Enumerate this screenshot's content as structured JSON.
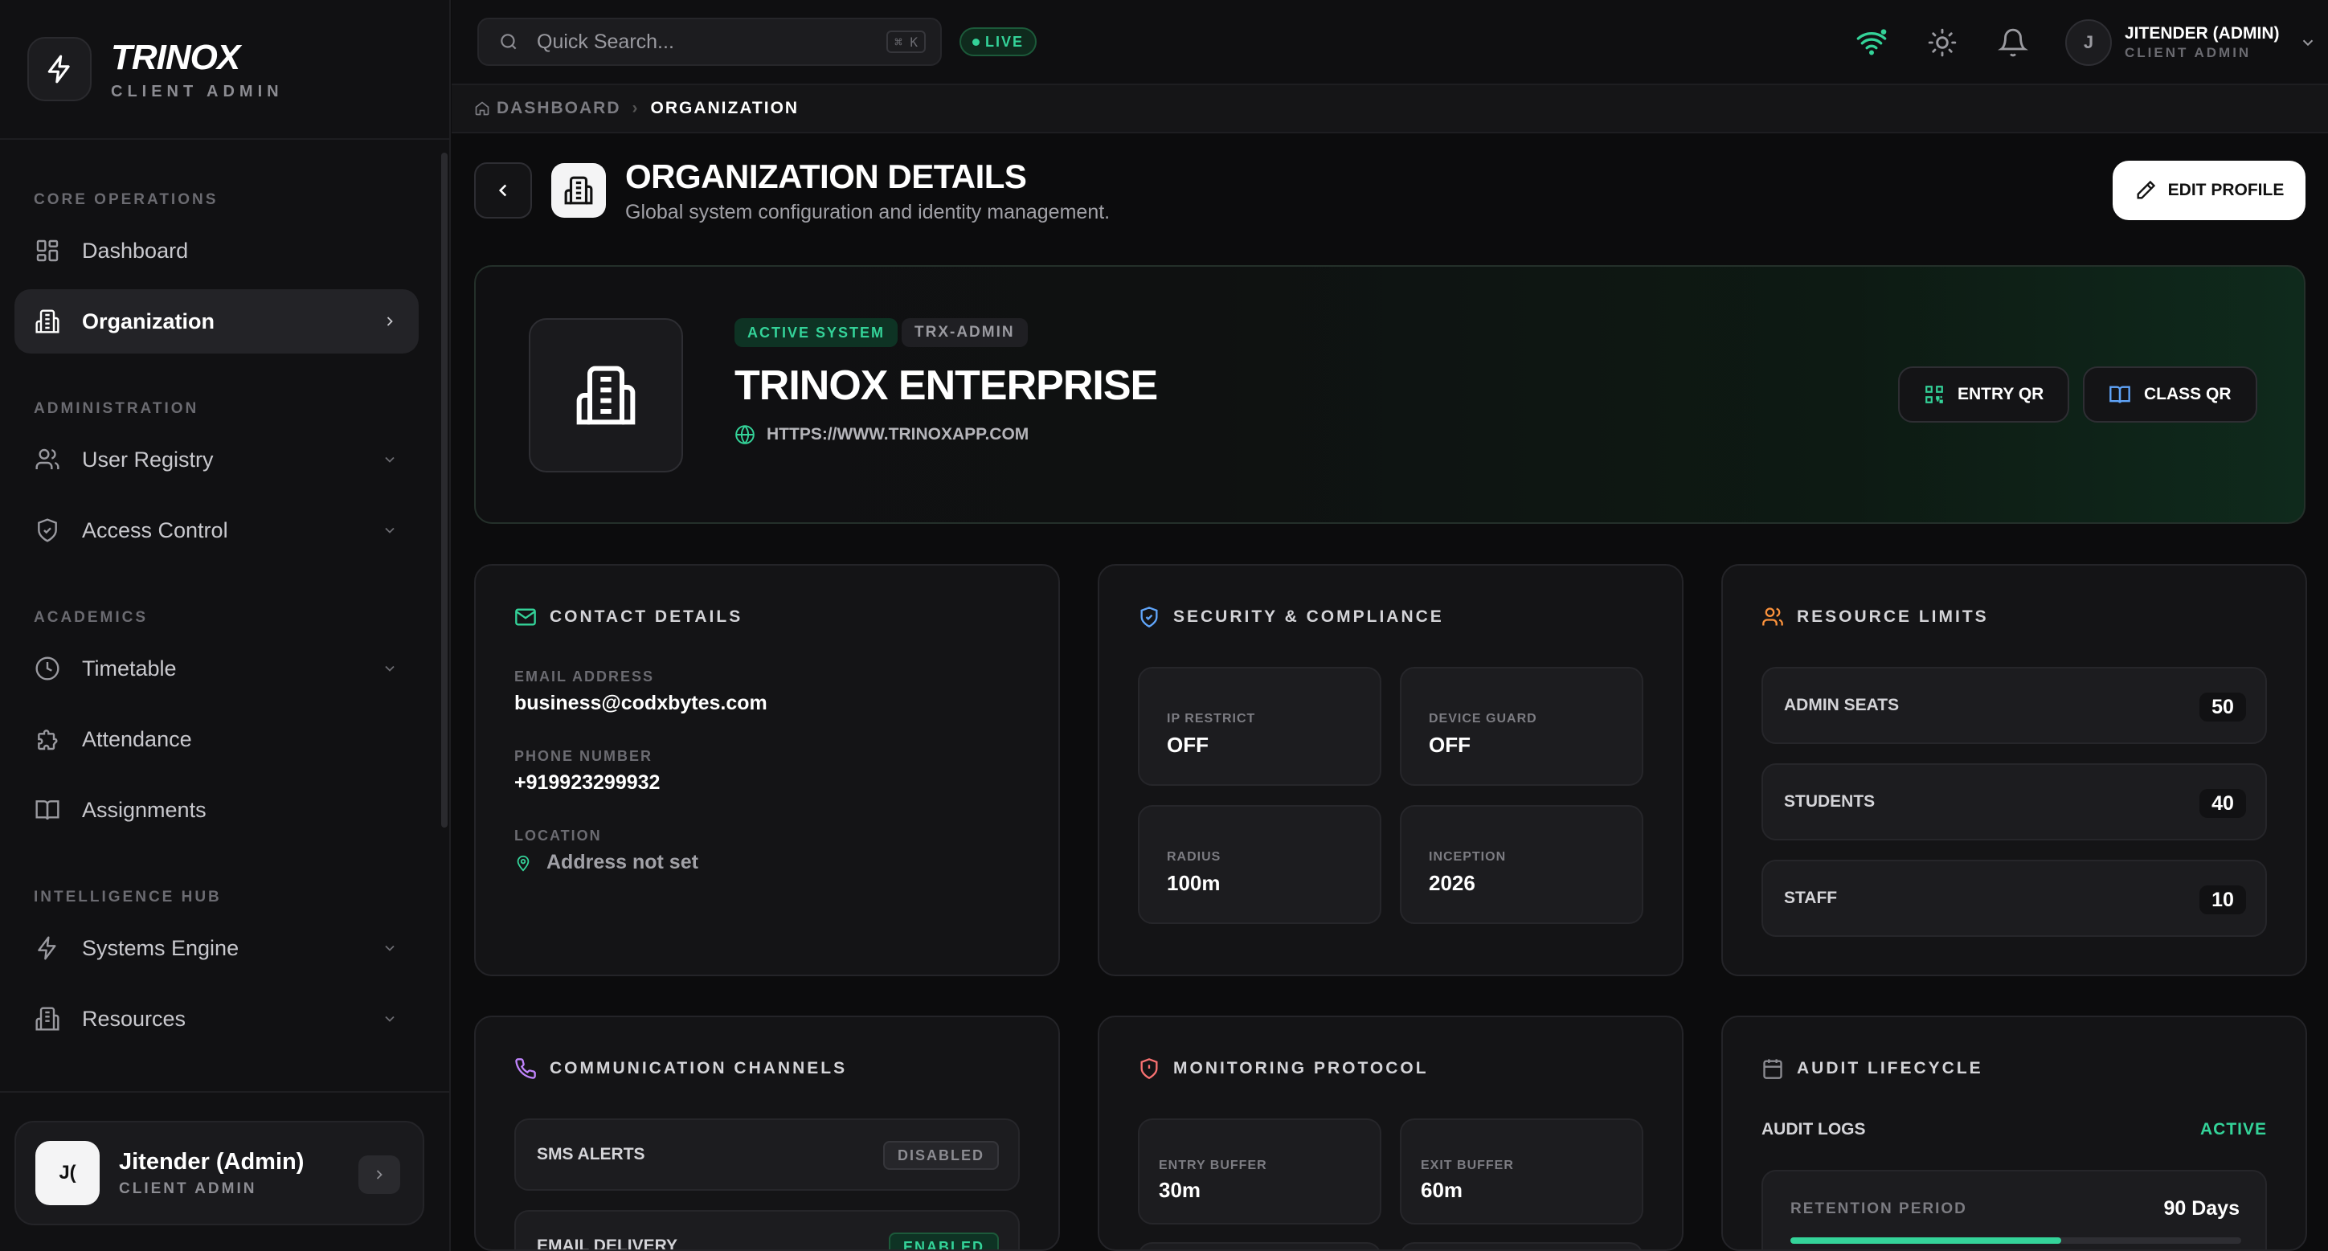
{
  "brand": {
    "name": "TRINOX",
    "subtitle": "CLIENT ADMIN"
  },
  "sidebar": {
    "sections": [
      {
        "title": "CORE OPERATIONS",
        "items": [
          {
            "label": "Dashboard",
            "icon": "dashboard-icon",
            "active": false
          },
          {
            "label": "Organization",
            "icon": "building-icon",
            "active": true
          }
        ]
      },
      {
        "title": "ADMINISTRATION",
        "items": [
          {
            "label": "User Registry",
            "icon": "users-icon"
          },
          {
            "label": "Access Control",
            "icon": "shield-icon"
          }
        ]
      },
      {
        "title": "ACADEMICS",
        "items": [
          {
            "label": "Timetable",
            "icon": "clock-icon"
          },
          {
            "label": "Attendance",
            "icon": "puzzle-icon"
          },
          {
            "label": "Assignments",
            "icon": "book-icon"
          }
        ]
      },
      {
        "title": "INTELLIGENCE HUB",
        "items": [
          {
            "label": "Systems Engine",
            "icon": "bolt-icon"
          },
          {
            "label": "Resources",
            "icon": "building-icon"
          }
        ]
      }
    ],
    "user": {
      "initials": "J(",
      "name": "Jitender (Admin)",
      "role": "CLIENT ADMIN"
    }
  },
  "topbar": {
    "search_placeholder": "Quick Search...",
    "shortcut": "⌘ K",
    "live_label": "LIVE",
    "user": {
      "initial": "J",
      "name": "JITENDER (ADMIN)",
      "role": "CLIENT ADMIN"
    }
  },
  "breadcrumb": {
    "home": "DASHBOARD",
    "current": "ORGANIZATION"
  },
  "header": {
    "title": "ORGANIZATION DETAILS",
    "subtitle": "Global system configuration and identity management.",
    "edit_label": "EDIT PROFILE"
  },
  "hero": {
    "status": "ACTIVE SYSTEM",
    "code": "TRX-ADMIN",
    "name": "TRINOX ENTERPRISE",
    "url": "HTTPS://WWW.TRINOXAPP.COM",
    "entry_qr": "ENTRY QR",
    "class_qr": "CLASS QR"
  },
  "contact": {
    "title": "CONTACT DETAILS",
    "email_label": "EMAIL ADDRESS",
    "email": "business@codxbytes.com",
    "phone_label": "PHONE NUMBER",
    "phone": "+919923299932",
    "location_label": "LOCATION",
    "location": "Address not set"
  },
  "security": {
    "title": "SECURITY & COMPLIANCE",
    "tiles": [
      {
        "label": "IP RESTRICT",
        "value": "OFF"
      },
      {
        "label": "DEVICE GUARD",
        "value": "OFF"
      },
      {
        "label": "RADIUS",
        "value": "100m"
      },
      {
        "label": "INCEPTION",
        "value": "2026"
      }
    ]
  },
  "resources": {
    "title": "RESOURCE LIMITS",
    "rows": [
      {
        "label": "ADMIN SEATS",
        "value": "50"
      },
      {
        "label": "STUDENTS",
        "value": "40"
      },
      {
        "label": "STAFF",
        "value": "10"
      }
    ]
  },
  "channels": {
    "title": "COMMUNICATION CHANNELS",
    "rows": [
      {
        "label": "SMS ALERTS",
        "status": "DISABLED"
      },
      {
        "label": "EMAIL DELIVERY",
        "status": "ENABLED"
      }
    ]
  },
  "monitoring": {
    "title": "MONITORING PROTOCOL",
    "tiles": [
      {
        "label": "ENTRY BUFFER",
        "value": "30m"
      },
      {
        "label": "EXIT BUFFER",
        "value": "60m"
      }
    ]
  },
  "audit": {
    "title": "AUDIT LIFECYCLE",
    "logs_label": "AUDIT LOGS",
    "logs_status": "ACTIVE",
    "retention_label": "RETENTION PERIOD",
    "retention_value": "90 Days",
    "retention_progress": 0.6
  },
  "colors": {
    "accent_green": "#34d399",
    "surface": "#141416",
    "background": "#0c0c0d"
  }
}
